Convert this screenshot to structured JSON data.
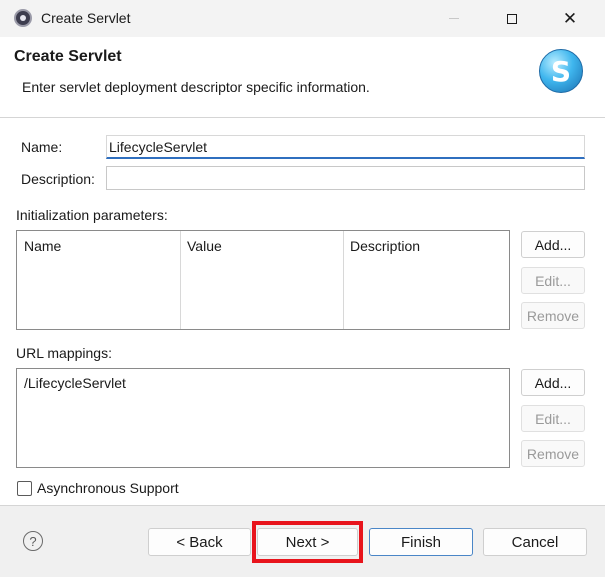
{
  "window": {
    "title": "Create Servlet",
    "controls": {
      "minimize": "",
      "maximize": "",
      "close": "✕"
    }
  },
  "banner": {
    "title": "Create Servlet",
    "description": "Enter servlet deployment descriptor specific information.",
    "logo_letter": "S"
  },
  "form": {
    "name_label": "Name:",
    "name_value": "LifecycleServlet",
    "description_label": "Description:",
    "description_value": ""
  },
  "init_params": {
    "label": "Initialization parameters:",
    "columns": [
      "Name",
      "Value",
      "Description"
    ],
    "rows": [],
    "buttons": {
      "add": "Add...",
      "edit": "Edit...",
      "remove": "Remove"
    }
  },
  "url_mappings": {
    "label": "URL mappings:",
    "items": [
      "/LifecycleServlet"
    ],
    "buttons": {
      "add": "Add...",
      "edit": "Edit...",
      "remove": "Remove"
    }
  },
  "async": {
    "label": "Asynchronous Support",
    "checked": false
  },
  "footer": {
    "help_icon": "?",
    "back": "< Back",
    "next": "Next >",
    "finish": "Finish",
    "cancel": "Cancel"
  },
  "colors": {
    "highlight": "#e8141c",
    "focus_underline": "#2f6fbf",
    "default_button_border": "#4a86c7"
  }
}
